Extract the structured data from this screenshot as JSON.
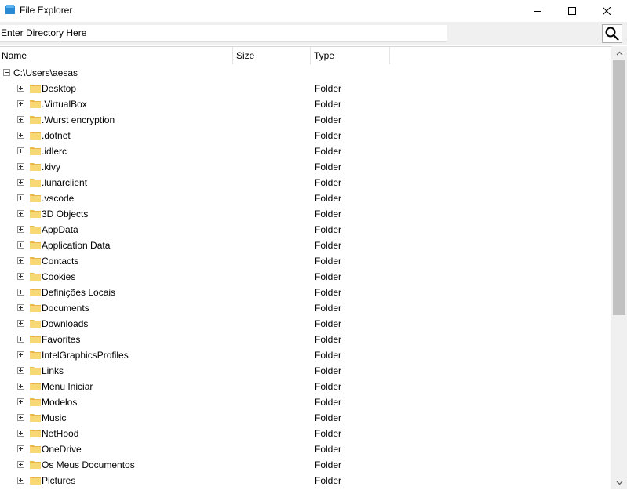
{
  "window": {
    "title": "File Explorer",
    "minimize_icon": "minimize-icon",
    "maximize_icon": "maximize-icon",
    "close_icon": "close-icon"
  },
  "address": {
    "placeholder": "Enter Directory Here",
    "value": ""
  },
  "search": {
    "icon": "search-icon"
  },
  "columns": {
    "name": "Name",
    "size": "Size",
    "type": "Type"
  },
  "root": {
    "path": "C:\\Users\\aesas"
  },
  "items": [
    {
      "name": "Desktop",
      "type": "Folder"
    },
    {
      "name": ".VirtualBox",
      "type": "Folder"
    },
    {
      "name": ".Wurst encryption",
      "type": "Folder"
    },
    {
      "name": ".dotnet",
      "type": "Folder"
    },
    {
      "name": ".idlerc",
      "type": "Folder"
    },
    {
      "name": ".kivy",
      "type": "Folder"
    },
    {
      "name": ".lunarclient",
      "type": "Folder"
    },
    {
      "name": ".vscode",
      "type": "Folder"
    },
    {
      "name": "3D Objects",
      "type": "Folder"
    },
    {
      "name": "AppData",
      "type": "Folder"
    },
    {
      "name": "Application Data",
      "type": "Folder"
    },
    {
      "name": "Contacts",
      "type": "Folder"
    },
    {
      "name": "Cookies",
      "type": "Folder"
    },
    {
      "name": "Definições Locais",
      "type": "Folder"
    },
    {
      "name": "Documents",
      "type": "Folder"
    },
    {
      "name": "Downloads",
      "type": "Folder"
    },
    {
      "name": "Favorites",
      "type": "Folder"
    },
    {
      "name": "IntelGraphicsProfiles",
      "type": "Folder"
    },
    {
      "name": "Links",
      "type": "Folder"
    },
    {
      "name": "Menu Iniciar",
      "type": "Folder"
    },
    {
      "name": "Modelos",
      "type": "Folder"
    },
    {
      "name": "Music",
      "type": "Folder"
    },
    {
      "name": "NetHood",
      "type": "Folder"
    },
    {
      "name": "OneDrive",
      "type": "Folder"
    },
    {
      "name": "Os Meus Documentos",
      "type": "Folder"
    },
    {
      "name": "Pictures",
      "type": "Folder"
    }
  ],
  "colors": {
    "folder": "#f8d775",
    "folder_dark": "#e8b84a",
    "app_icon": "#2a8ad4"
  }
}
